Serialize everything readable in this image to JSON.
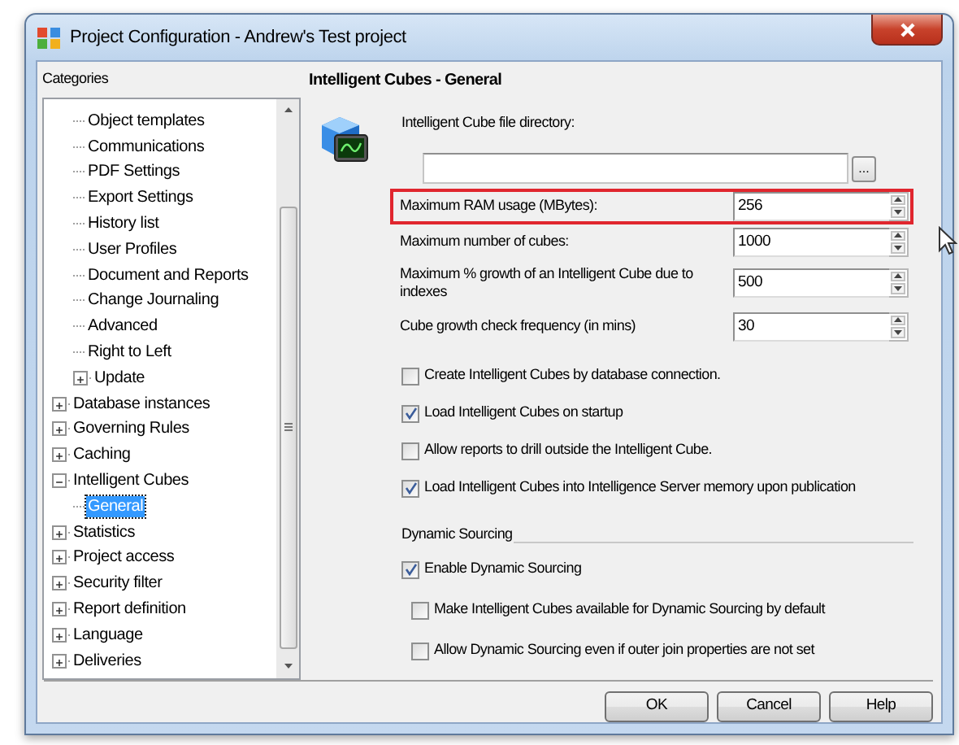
{
  "window": {
    "title": "Project Configuration - Andrew's Test project"
  },
  "categories": {
    "label": "Categories",
    "partial_children": [
      {
        "label": "Object templates",
        "selected": false
      },
      {
        "label": "Communications",
        "selected": false
      },
      {
        "label": "PDF Settings",
        "selected": false
      },
      {
        "label": "Export Settings",
        "selected": false
      },
      {
        "label": "History list",
        "selected": false
      },
      {
        "label": "User Profiles",
        "selected": false
      },
      {
        "label": "Document and Reports",
        "selected": false
      },
      {
        "label": "Change Journaling",
        "selected": false
      },
      {
        "label": "Advanced",
        "selected": false
      },
      {
        "label": "Right to Left",
        "selected": false
      },
      {
        "label": "Update",
        "selected": false,
        "expanded": false
      }
    ],
    "items": [
      {
        "label": "Database instances",
        "selected": false,
        "expanded": false
      },
      {
        "label": "Governing Rules",
        "selected": false,
        "expanded": false
      },
      {
        "label": "Caching",
        "selected": false,
        "expanded": false
      },
      {
        "label": "Intelligent Cubes",
        "selected": false,
        "expanded": true,
        "children": [
          {
            "label": "General",
            "selected": true
          }
        ]
      },
      {
        "label": "Statistics",
        "selected": false,
        "expanded": false
      },
      {
        "label": "Project access",
        "selected": false,
        "expanded": false
      },
      {
        "label": "Security filter",
        "selected": false,
        "expanded": false
      },
      {
        "label": "Report definition",
        "selected": false,
        "expanded": false
      },
      {
        "label": "Language",
        "selected": false,
        "expanded": false
      },
      {
        "label": "Deliveries",
        "selected": false,
        "expanded": false
      }
    ]
  },
  "panel": {
    "title": "Intelligent Cubes - General",
    "directory": {
      "label": "Intelligent Cube file directory:",
      "browse": "..."
    },
    "spinners": [
      {
        "label": "Maximum RAM usage (MBytes):",
        "value": "256",
        "highlighted": true
      },
      {
        "label": "Maximum number of cubes:",
        "value": "1000",
        "highlighted": false
      },
      {
        "label": "Maximum % growth of an Intelligent Cube due to indexes",
        "value": "500",
        "highlighted": false
      },
      {
        "label": "Cube growth check frequency (in mins)",
        "value": "30",
        "highlighted": false
      }
    ],
    "checkboxes": [
      {
        "label": "Create Intelligent Cubes by database connection.",
        "checked": false
      },
      {
        "label": "Load Intelligent Cubes on startup",
        "checked": true
      },
      {
        "label": "Allow reports to drill outside the Intelligent Cube.",
        "checked": false
      },
      {
        "label": "Load Intelligent Cubes into Intelligence Server memory upon publication",
        "checked": true
      }
    ],
    "section": {
      "title": "Dynamic Sourcing",
      "checkboxes": [
        {
          "label": "Enable Dynamic Sourcing",
          "checked": true,
          "children": [
            {
              "label": "Make Intelligent Cubes available for Dynamic Sourcing by default",
              "checked": false
            },
            {
              "label": "Allow Dynamic Sourcing even if outer join properties are not set",
              "checked": false
            }
          ]
        }
      ]
    }
  },
  "buttons": [
    "OK",
    "Cancel",
    "Help"
  ]
}
